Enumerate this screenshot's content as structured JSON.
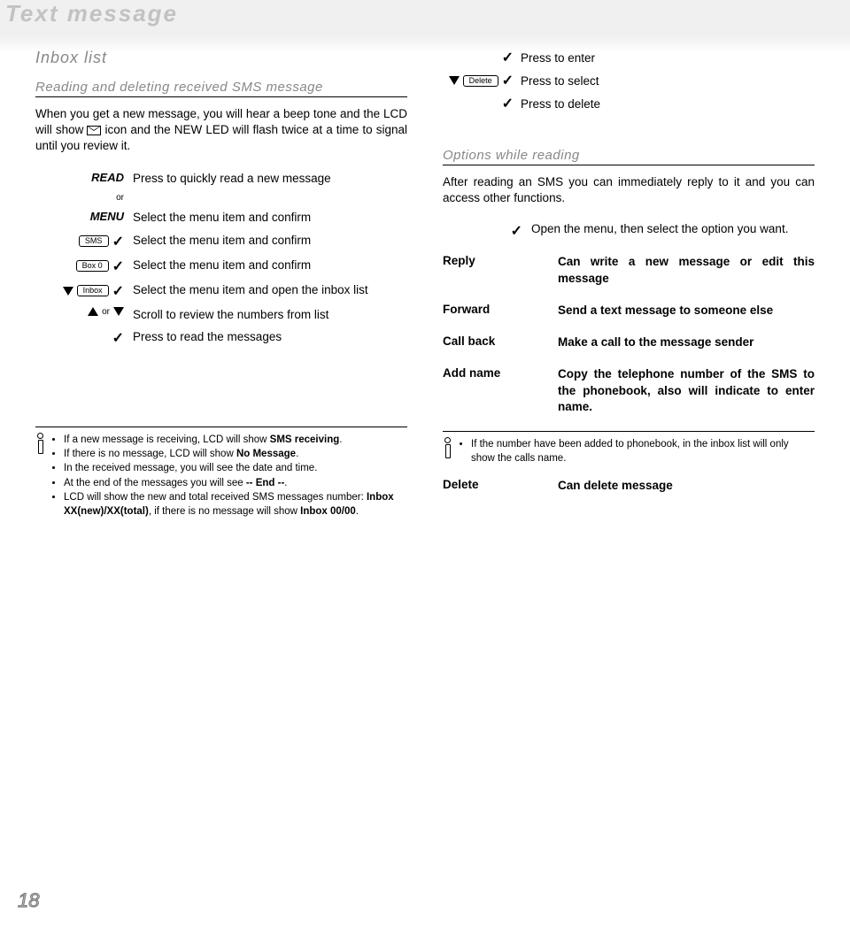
{
  "banner": "Text message",
  "page_number": "18",
  "left": {
    "h_inbox": "Inbox list",
    "h_sub": "Reading and deleting received SMS message",
    "intro_pre": "When you get a new message, you will hear a beep tone and the LCD will show ",
    "intro_post": " icon and the NEW LED will flash twice at a time to signal until you review it.",
    "steps": {
      "read_key": "READ",
      "or1": "or",
      "menu_key": "MENU",
      "sms_pill": "SMS",
      "box0_pill": "Box 0",
      "inbox_pill": "Inbox",
      "or2": "or",
      "d_read": "Press to quickly read a new message",
      "d_menu": "Select the menu item and confirm",
      "d_sms": "Select the menu item and confirm",
      "d_box0": "Select the menu item and confirm",
      "d_inbox": "Select the menu item and open the inbox list",
      "d_scroll": "Scroll to review the numbers from list",
      "d_press": "Press to read the messages"
    },
    "notes": {
      "n1_pre": "If a new message is receiving, LCD will show ",
      "n1_bold": "SMS receiving",
      "n1_post": ".",
      "n2_pre": "If there is no message, LCD will show ",
      "n2_bold": "No Message",
      "n2_post": ".",
      "n3": "In the received message, you will see the date and time.",
      "n4_pre": "At the end of the messages you will see ",
      "n4_bold": "-- End --",
      "n4_post": ".",
      "n5_pre": "LCD will show the new and total received SMS messages number: ",
      "n5_bold1": "Inbox XX(new)/XX(total)",
      "n5_mid": ", if there is no message will show ",
      "n5_bold2": "Inbox 00/00",
      "n5_post": "."
    }
  },
  "right": {
    "delete_pill": "Delete",
    "r_enter": "Press to enter",
    "r_select": "Press to select",
    "r_delete": "Press to delete",
    "h_options": "Options while reading",
    "options_intro": "After reading an SMS you can immediately reply to it and you can access other functions.",
    "open_menu": "Open the menu, then select the option you want.",
    "rows": {
      "reply_k": "Reply",
      "reply_v": "Can write a new message or edit this message",
      "forward_k": "Forward",
      "forward_v": "Send a text message to someone else",
      "callback_k": "Call back",
      "callback_v": "Make a call to the message sender",
      "addname_k": "Add name",
      "addname_v": "Copy the telephone number of the SMS to the phonebook, also will indicate to enter name.",
      "delete_k": "Delete",
      "delete_v": "Can delete message"
    },
    "note": "If the number have been added to phonebook, in the inbox list will only show the calls name."
  }
}
